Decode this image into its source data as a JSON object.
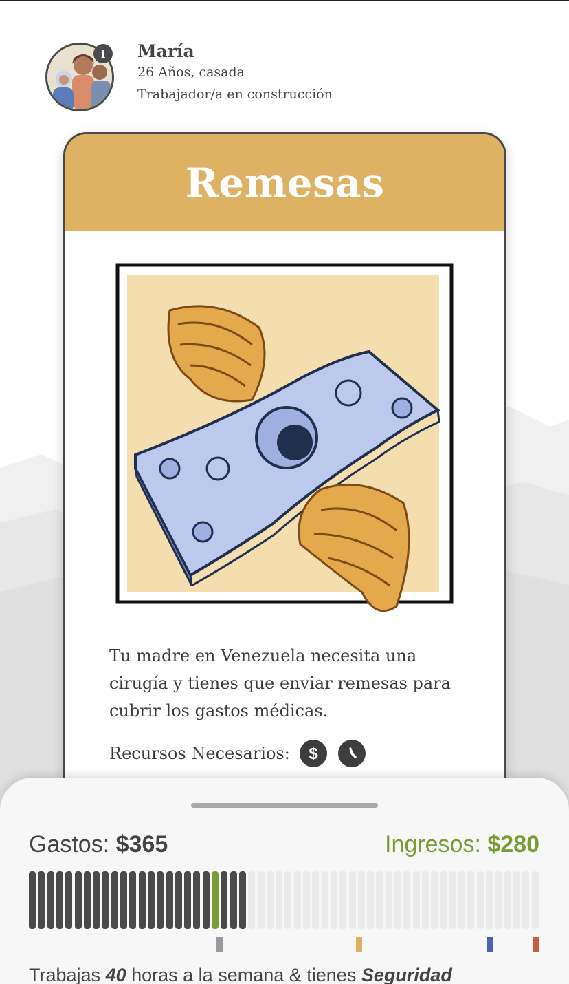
{
  "profile": {
    "name": "María",
    "age_status": "26 Años, casada",
    "occupation": "Trabajador/a en construcción",
    "info_icon": "info-icon"
  },
  "card": {
    "title": "Remesas",
    "illustration": "flying-dollar-bills-illustration",
    "description": "Tu madre en Venezuela necesita una cirugía y tienes que enviar remesas para cubrir los gastos médicas.",
    "resources_label": "Recursos Necesarios:",
    "resource_icons": [
      "dollar-icon",
      "clock-icon"
    ]
  },
  "budget": {
    "expenses_label": "Gastos:",
    "expenses_value": "$365",
    "income_label": "Ingresos:",
    "income_value": "$280",
    "total_segments": 56,
    "filled_segments": 24,
    "income_marker_segment": 20,
    "tick_colors": [
      "#9a9a9a",
      "#ddb263",
      "#4d62a8",
      "#c0603f"
    ],
    "hours_prefix": "Trabajas",
    "hours_value": "40",
    "hours_middle": "horas a la semana & tienes",
    "hours_benefit": "Seguridad"
  },
  "colors": {
    "card_header": "#ddb263",
    "income_green": "#7a9c36",
    "bar_filled": "#4a4a4a",
    "bar_empty": "#ebebeb",
    "income_marker": "#7a9c36"
  }
}
